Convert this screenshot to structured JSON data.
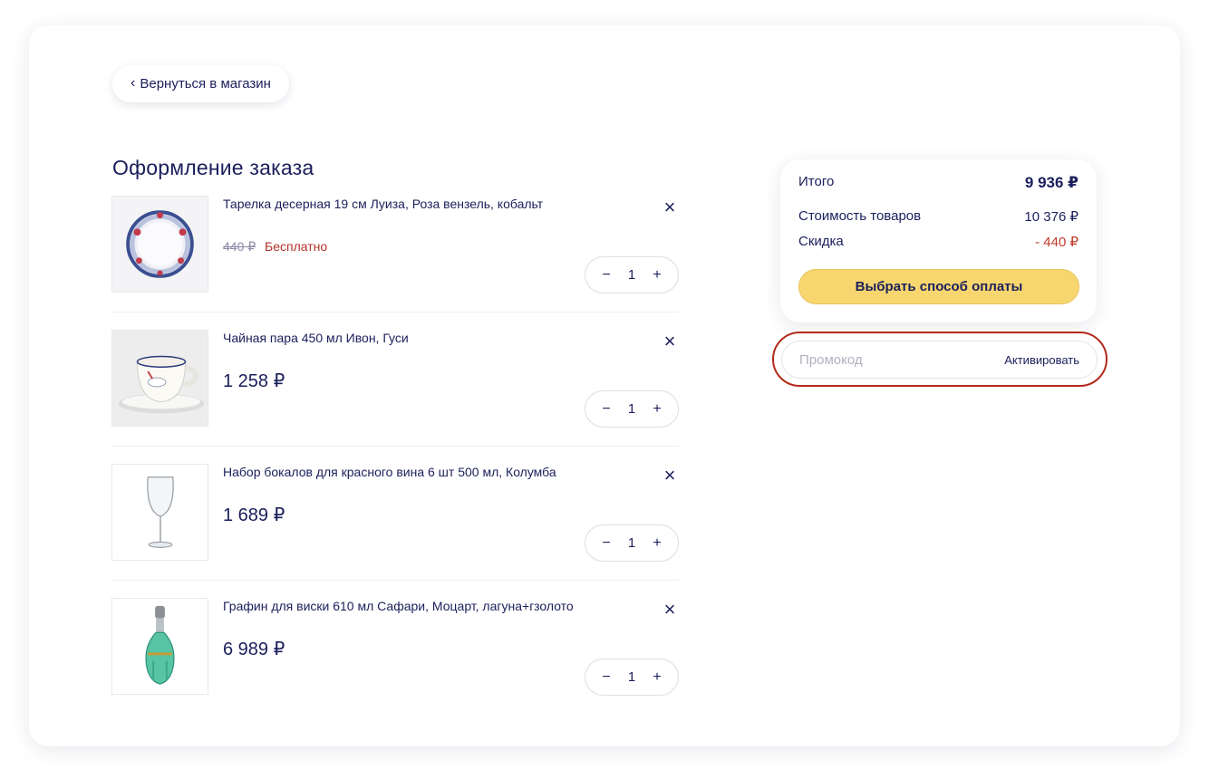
{
  "back_button": {
    "label": "Вернуться в магазин"
  },
  "page_title": "Оформление заказа",
  "items": [
    {
      "name": "Тарелка десерная 19 см Луиза, Роза вензель, кобальт",
      "old_price": "440 ₽",
      "price": "Бесплатно",
      "quantity": "1",
      "image_icon": "plate-icon"
    },
    {
      "name": "Чайная пара 450 мл Ивон, Гуси",
      "price": "1 258 ₽",
      "quantity": "1",
      "image_icon": "tea-cup-icon"
    },
    {
      "name": "Набор бокалов для красного вина 6 шт 500 мл, Колумба",
      "price": "1 689 ₽",
      "quantity": "1",
      "image_icon": "wine-glass-icon"
    },
    {
      "name": "Графин для виски 610 мл Сафари, Моцарт, лагуна+гзолото",
      "price": "6 989 ₽",
      "quantity": "1",
      "image_icon": "decanter-icon"
    }
  ],
  "controls": {
    "remove": "×",
    "minus": "−",
    "plus": "+"
  },
  "summary": {
    "total_label": "Итого",
    "total_value": "9 936 ₽",
    "cost_label": "Стоимость товаров",
    "cost_value": "10 376 ₽",
    "discount_label": "Скидка",
    "discount_value": "- 440 ₽",
    "pay_button": "Выбрать способ оплаты"
  },
  "promo": {
    "placeholder": "Промокод",
    "value": "",
    "activate_label": "Активировать"
  },
  "colors": {
    "text": "#1b1f5b",
    "accent_yellow": "#f7d66f",
    "discount_red": "#c0392b",
    "free_red": "#b1342a",
    "highlight_outline": "#b22a1a"
  }
}
